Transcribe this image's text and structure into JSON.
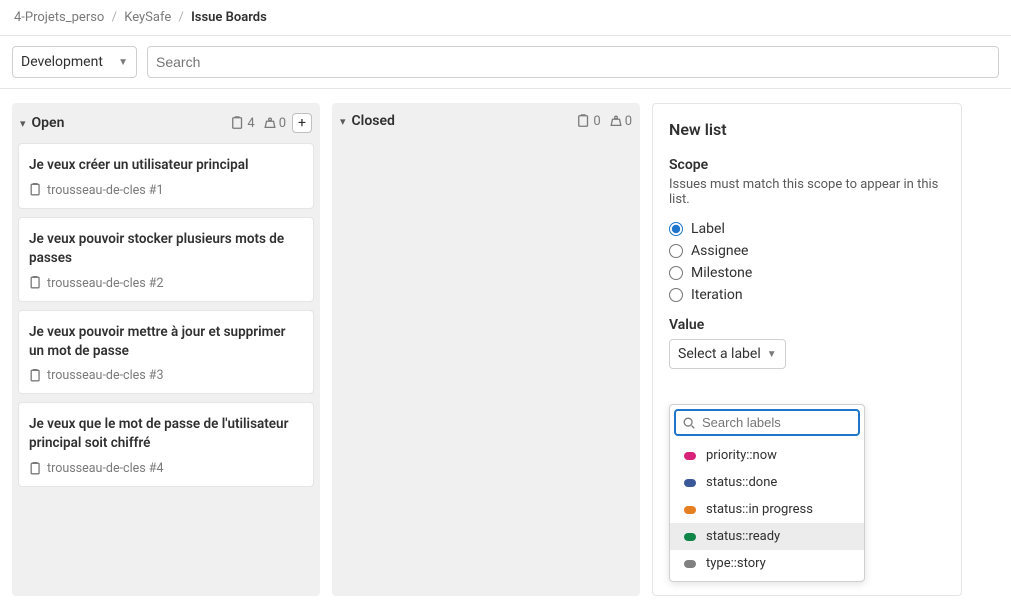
{
  "breadcrumb": {
    "parent1": "4-Projets_perso",
    "parent2": "KeySafe",
    "current": "Issue Boards"
  },
  "toolbar": {
    "board_name": "Development",
    "search_placeholder": "Search"
  },
  "columns": {
    "open": {
      "title": "Open",
      "issue_count": "4",
      "weight_count": "0",
      "cards": [
        {
          "title": "Je veux créer un utilisateur principal",
          "ref": "trousseau-de-cles #1"
        },
        {
          "title": "Je veux pouvoir stocker plusieurs mots de passes",
          "ref": "trousseau-de-cles #2"
        },
        {
          "title": "Je veux pouvoir mettre à jour et supprimer un mot de passe",
          "ref": "trousseau-de-cles #3"
        },
        {
          "title": "Je veux que le mot de passe de l'utilisateur principal soit chiffré",
          "ref": "trousseau-de-cles #4"
        }
      ]
    },
    "closed": {
      "title": "Closed",
      "issue_count": "0",
      "weight_count": "0"
    }
  },
  "newlist": {
    "heading": "New list",
    "scope_label": "Scope",
    "scope_desc": "Issues must match this scope to appear in this list.",
    "radios": {
      "label": "Label",
      "assignee": "Assignee",
      "milestone": "Milestone",
      "iteration": "Iteration"
    },
    "value_label": "Value",
    "select_btn": "Select a label",
    "search_labels_placeholder": "Search labels",
    "options": [
      {
        "text": "priority::now",
        "color": "#d8227a"
      },
      {
        "text": "status::done",
        "color": "#3b5998"
      },
      {
        "text": "status::in progress",
        "color": "#e67e22"
      },
      {
        "text": "status::ready",
        "color": "#108548"
      },
      {
        "text": "type::story",
        "color": "#808080"
      }
    ],
    "highlighted_index": 3
  }
}
